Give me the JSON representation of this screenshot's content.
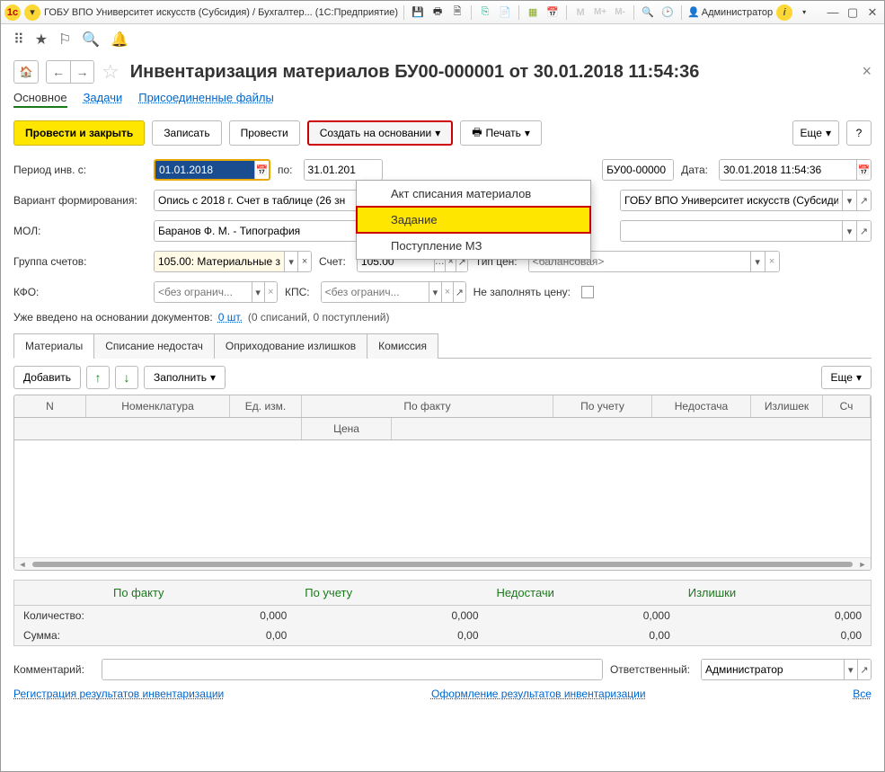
{
  "title_bar": {
    "app_title": "ГОБУ ВПО Университет искусств (Субсидия) / Бухгалтер...   (1С:Предприятие)",
    "user": "Администратор"
  },
  "document": {
    "title": "Инвентаризация материалов БУ00-000001 от 30.01.2018 11:54:36"
  },
  "function_bar": {
    "main": "Основное",
    "tasks": "Задачи",
    "files": "Присоединенные файлы"
  },
  "actions": {
    "post_close": "Провести и закрыть",
    "save": "Записать",
    "post": "Провести",
    "create_based": "Создать на основании",
    "print": "Печать",
    "more": "Еще"
  },
  "dropdown": {
    "item1": "Акт списания материалов",
    "item2": "Задание",
    "item3": "Поступление МЗ"
  },
  "fields": {
    "period_label": "Период инв. с:",
    "period_from": "01.01.2018",
    "period_to_label": "по:",
    "period_to": "31.01.201",
    "number_value": "БУ00-00000",
    "date_label": "Дата:",
    "date_value": "30.01.2018 11:54:36",
    "variant_label": "Вариант формирования:",
    "variant_value": "Опись с 2018 г. Счет в таблице (26 зн",
    "org_value": "ГОБУ ВПО Университет искусств (Субсиди",
    "mol_label": "МОЛ:",
    "mol_value": "Баранов Ф. М. - Типография",
    "group_label": "Группа счетов:",
    "group_value": "105.00: Материальные за",
    "account_label": "Счет:",
    "account_value": "105.00",
    "price_type_label": "Тип цен:",
    "price_type_placeholder": "<балансовая>",
    "kfo_label": "КФО:",
    "kfo_placeholder": "<без огранич...",
    "kps_label": "КПС:",
    "kps_placeholder": "<без огранич...",
    "no_fill_price_label": "Не заполнять цену:"
  },
  "already": {
    "label": "Уже введено на основании документов:",
    "count": "0 шт.",
    "detail": "(0 списаний, 0 поступлений)"
  },
  "tabs": {
    "t1": "Материалы",
    "t2": "Списание недостач",
    "t3": "Оприходование излишков",
    "t4": "Комиссия"
  },
  "tab_toolbar": {
    "add": "Добавить",
    "fill": "Заполнить",
    "more": "Еще"
  },
  "table_headers": {
    "n": "N",
    "nom": "Номенклатура",
    "ed": "Ед. изм.",
    "fact": "По факту",
    "uch": "По учету",
    "ned": "Недостача",
    "izl": "Излишек",
    "sc": "Сч",
    "cena": "Цена"
  },
  "summary": {
    "h1": "По факту",
    "h2": "По учету",
    "h3": "Недостачи",
    "h4": "Излишки",
    "qty_label": "Количество:",
    "sum_label": "Сумма:",
    "zero3": "0,000",
    "zero2": "0,00"
  },
  "footer": {
    "comment_label": "Комментарий:",
    "responsible_label": "Ответственный:",
    "responsible_value": "Администратор",
    "link1": "Регистрация результатов инвентаризации",
    "link2": "Оформление результатов инвентаризации",
    "all": "Все"
  }
}
